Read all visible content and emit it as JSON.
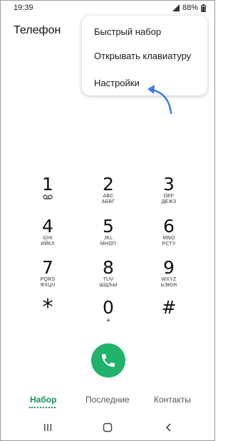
{
  "status_bar": {
    "time": "19:39",
    "battery": "88%"
  },
  "header": {
    "title": "Телефон"
  },
  "menu": {
    "items": [
      {
        "label": "Быстрый набор"
      },
      {
        "label": "Открывать клавиатуру"
      },
      {
        "label": "Настройки"
      }
    ]
  },
  "annotation": {
    "arrow_color": "#3a7be0",
    "points_to": "Настройки"
  },
  "keypad": {
    "keys": [
      {
        "digit": "1",
        "latin": "",
        "cyrillic": "",
        "icon": "voicemail-icon"
      },
      {
        "digit": "2",
        "latin": "ABC",
        "cyrillic": "АБВГ"
      },
      {
        "digit": "3",
        "latin": "DEF",
        "cyrillic": "ДЕЖЗ"
      },
      {
        "digit": "4",
        "latin": "GHI",
        "cyrillic": "ИЙКЛ"
      },
      {
        "digit": "5",
        "latin": "JKL",
        "cyrillic": "МНОП"
      },
      {
        "digit": "6",
        "latin": "MNO",
        "cyrillic": "РСТУ"
      },
      {
        "digit": "7",
        "latin": "PQRS",
        "cyrillic": "ФХЦЧ"
      },
      {
        "digit": "8",
        "latin": "TUV",
        "cyrillic": "ШЩЪЫ"
      },
      {
        "digit": "9",
        "latin": "WXYZ",
        "cyrillic": "ЬЭЮЯ"
      },
      {
        "digit": "*",
        "latin": "",
        "cyrillic": ""
      },
      {
        "digit": "0",
        "latin": "+",
        "cyrillic": ""
      },
      {
        "digit": "#",
        "latin": "",
        "cyrillic": ""
      }
    ]
  },
  "call": {
    "color": "#21b26b",
    "icon": "phone-icon"
  },
  "tabs": [
    {
      "label": "Набор",
      "active": true
    },
    {
      "label": "Последние",
      "active": false
    },
    {
      "label": "Контакты",
      "active": false
    }
  ],
  "navigation": {
    "icons": [
      "recent-apps-icon",
      "home-icon",
      "back-icon"
    ]
  }
}
